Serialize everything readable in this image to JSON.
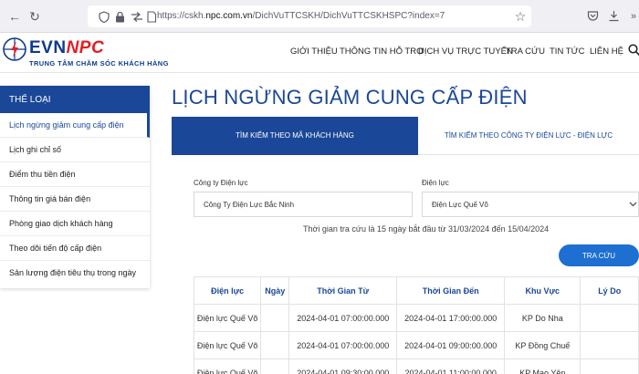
{
  "browser": {
    "url_prefix": "https://cskh.",
    "url_host": "npc.com.vn",
    "url_path": "/DichVuTTCSKH/DichVuTTCSKHSPC?index=7"
  },
  "header": {
    "logo_evn": "EVN",
    "logo_npc": "NPC",
    "logo_subtitle": "TRUNG TÂM CHĂM SÓC KHÁCH HÀNG",
    "menu": [
      "GIỚI THIỆU",
      "THÔNG TIN HỖ TRỢ",
      "DỊCH VỤ TRỰC TUYẾN",
      "TRA CỨU",
      "TIN TỨC",
      "LIÊN HỆ"
    ]
  },
  "sidebar": {
    "title": "THỂ LOẠI",
    "items": [
      "Lịch ngừng giảm cung cấp điện",
      "Lịch ghi chỉ số",
      "Điểm thu tiền điện",
      "Thông tin giá bán điện",
      "Phòng giao dịch khách hàng",
      "Theo dõi tiến độ cấp điện",
      "Sản lượng điện tiêu thụ trong ngày"
    ]
  },
  "main": {
    "title": "LỊCH NGỪNG GIẢM CUNG CẤP ĐIỆN",
    "tabs": [
      "TÌM KIẾM THEO MÃ KHÁCH HÀNG",
      "TÌM KIẾM THEO CÔNG TY ĐIỆN LỰC - ĐIỆN LỰC"
    ],
    "company_label": "Công ty Điện lực",
    "company_value": "Công Ty Điện Lực Bắc Ninh",
    "branch_label": "Điện lực",
    "branch_value": "Điện Lực Quế Võ",
    "time_note": "Thời gian tra cứu là 15 ngày bắt đầu từ 31/03/2024 đến 15/04/2024",
    "search_label": "TRA CỨU"
  },
  "table": {
    "headers": [
      "Điện lực",
      "Ngày",
      "Thời Gian Từ",
      "Thời Gian Đến",
      "Khu Vực",
      "Lý Do"
    ],
    "rows": [
      [
        "Điện lực Quế Võ",
        "",
        "2024-04-01 07:00:00.000",
        "2024-04-01 17:00:00.000",
        "KP Do Nha",
        ""
      ],
      [
        "Điện lực Quế Võ",
        "",
        "2024-04-01 07:00:00.000",
        "2024-04-01 09:00:00.000",
        "KP Đồng Chuế",
        ""
      ],
      [
        "Điện lực Quế Võ",
        "",
        "2024-04-01 09:30:00.000",
        "2024-04-01 11:00:00.000",
        "KP Mao Yên",
        ""
      ]
    ]
  }
}
